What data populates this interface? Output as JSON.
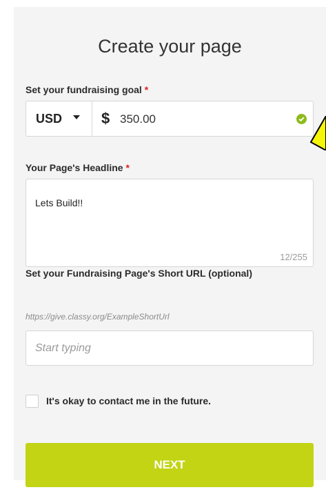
{
  "form": {
    "title": "Create your page",
    "goal_label": "Set your fundraising goal",
    "required_mark": "*",
    "currency": "USD",
    "currency_symbol": "$",
    "amount": "350.00",
    "headline_label": "Your Page's Headline",
    "headline_value": "Lets Build!!",
    "headline_counter": "12/255",
    "short_url_label": "Set your Fundraising Page's Short URL (optional)",
    "short_url_hint": "https://give.classy.org/ExampleShortUrl",
    "short_url_placeholder": "Start typing",
    "contact_label": "It's okay to contact me in the future.",
    "next_label": "NEXT"
  },
  "icons": {
    "caret": "chevron-down-icon",
    "check": "check-circle-icon",
    "annotation": "arrow-icon"
  },
  "colors": {
    "accent": "#c2d414",
    "valid": "#8dbb1e",
    "required": "#e02020",
    "annotation_fill": "#f5f50a"
  }
}
